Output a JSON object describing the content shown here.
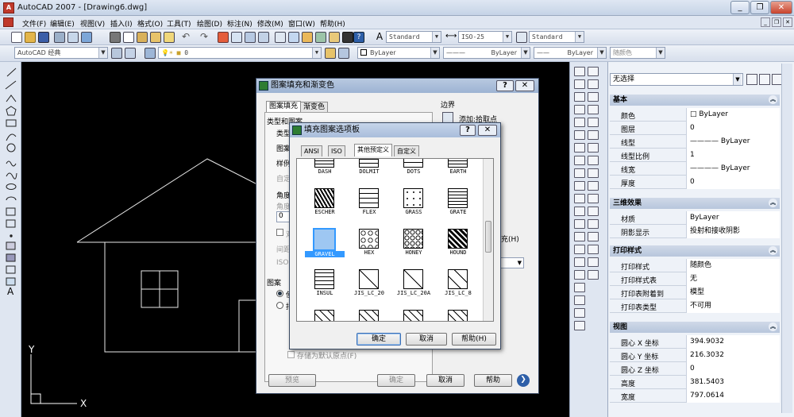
{
  "app": {
    "title": "AutoCAD 2007 - [Drawing6.dwg]"
  },
  "window": {
    "minimize": "_",
    "restore": "❐",
    "close": "✕"
  },
  "menu": [
    "文件(F)",
    "编辑(E)",
    "视图(V)",
    "插入(I)",
    "格式(O)",
    "工具(T)",
    "绘图(D)",
    "标注(N)",
    "修改(M)",
    "窗口(W)",
    "帮助(H)"
  ],
  "toolbar1": {
    "text_style": "Standard",
    "dim_style": "ISO-25",
    "table_style": "Standard"
  },
  "toolbar2": {
    "workspace": "AutoCAD 经典",
    "layer": "0",
    "color": "ByLayer",
    "linetype": "ByLayer",
    "lineweight": "ByLayer",
    "plotstyle": "随颜色"
  },
  "canvas": {
    "ucs_x": "X",
    "ucs_y": "Y"
  },
  "props": {
    "selection": "无选择",
    "sections": [
      {
        "title": "基本",
        "rows": [
          [
            "颜色",
            "□ ByLayer"
          ],
          [
            "图层",
            "0"
          ],
          [
            "线型",
            "———— ByLayer"
          ],
          [
            "线型比例",
            "1"
          ],
          [
            "线宽",
            "———— ByLayer"
          ],
          [
            "厚度",
            "0"
          ]
        ]
      },
      {
        "title": "三维效果",
        "rows": [
          [
            "材质",
            "ByLayer"
          ],
          [
            "阴影显示",
            "投射和接收阴影"
          ]
        ]
      },
      {
        "title": "打印样式",
        "rows": [
          [
            "打印样式",
            "随颜色"
          ],
          [
            "打印样式表",
            "无"
          ],
          [
            "打印表附着到",
            "模型"
          ],
          [
            "打印表类型",
            "不可用"
          ]
        ]
      },
      {
        "title": "视图",
        "rows": [
          [
            "圆心 X 坐标",
            "394.9032"
          ],
          [
            "圆心 Y 坐标",
            "216.3032"
          ],
          [
            "圆心 Z 坐标",
            "0"
          ],
          [
            "高度",
            "381.5403"
          ],
          [
            "宽度",
            "797.0614"
          ]
        ]
      }
    ]
  },
  "hatch_dialog": {
    "title": "图案填充和渐变色",
    "help": "?",
    "close": "✕",
    "tabs": [
      "图案填充",
      "渐变色"
    ],
    "type_pattern": "类型和图案",
    "type": "类型",
    "pattern": "图案",
    "swatch": "样例",
    "custom": "自定",
    "angle_scale": "角度",
    "angle": "角度",
    "angle_val": "0",
    "double": "双",
    "spacing": "间距",
    "iso": "ISO",
    "origin": "图案",
    "use_current": "使",
    "specified": "指",
    "store_default": "存储为默认原点(F)",
    "boundary": "边界",
    "add_pick": "添加:拾取点",
    "fill_label": "充(H)",
    "preview": "预览",
    "ok": "确定",
    "cancel": "取消",
    "help_btn": "帮助"
  },
  "palette": {
    "title": "填充图案选项板",
    "help": "?",
    "close": "✕",
    "tabs": [
      "ANSI",
      "ISO",
      "其他预定义",
      "自定义"
    ],
    "patterns": [
      "DASH",
      "DOLMIT",
      "DOTS",
      "EARTH",
      "ESCHER",
      "FLEX",
      "GRASS",
      "GRATE",
      "GRAVEL",
      "HEX",
      "HONEY",
      "HOUND",
      "INSUL",
      "JIS_LC_20",
      "JIS_LC_20A",
      "JIS_LC_8"
    ],
    "selected": "GRAVEL",
    "ok": "确定",
    "cancel": "取消",
    "help_btn": "帮助(H)"
  },
  "colors": {
    "selection": "#3399ff",
    "canvas": "#000000"
  }
}
